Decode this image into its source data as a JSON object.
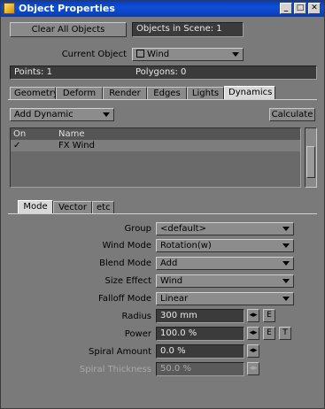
{
  "window": {
    "title": "Object Properties"
  },
  "toolbar": {
    "clear_all": "Clear All Objects",
    "objects_in_scene": "Objects in Scene: 1"
  },
  "current_object": {
    "label": "Current Object",
    "value": "Wind"
  },
  "stats": {
    "points": "Points: 1",
    "polygons": "Polygons: 0"
  },
  "tabs": [
    {
      "label": "Geometry",
      "active": false
    },
    {
      "label": "Deform",
      "active": false
    },
    {
      "label": "Render",
      "active": false
    },
    {
      "label": "Edges",
      "active": false
    },
    {
      "label": "Lights",
      "active": false
    },
    {
      "label": "Dynamics",
      "active": true
    }
  ],
  "dynamics": {
    "add_dynamic": "Add Dynamic",
    "calculate": "Calculate",
    "list": {
      "columns": [
        "On",
        "Name"
      ],
      "rows": [
        {
          "on": "✓",
          "name": "FX Wind"
        }
      ]
    }
  },
  "subtabs": [
    {
      "label": "Mode",
      "active": true
    },
    {
      "label": "Vector",
      "active": false
    },
    {
      "label": "etc",
      "active": false
    }
  ],
  "props": {
    "group": {
      "label": "Group",
      "value": "<default>"
    },
    "wind_mode": {
      "label": "Wind Mode",
      "value": "Rotation(w)"
    },
    "blend_mode": {
      "label": "Blend Mode",
      "value": "Add"
    },
    "size_effect": {
      "label": "Size Effect",
      "value": "Wind"
    },
    "falloff_mode": {
      "label": "Falloff Mode",
      "value": "Linear"
    },
    "radius": {
      "label": "Radius",
      "value": "300 mm"
    },
    "power": {
      "label": "Power",
      "value": "100.0 %"
    },
    "spiral_amount": {
      "label": "Spiral Amount",
      "value": "0.0 %"
    },
    "spiral_thickness": {
      "label": "Spiral Thickness",
      "value": "50.0 %"
    }
  },
  "buttons": {
    "envelope": "E",
    "texture": "T"
  }
}
